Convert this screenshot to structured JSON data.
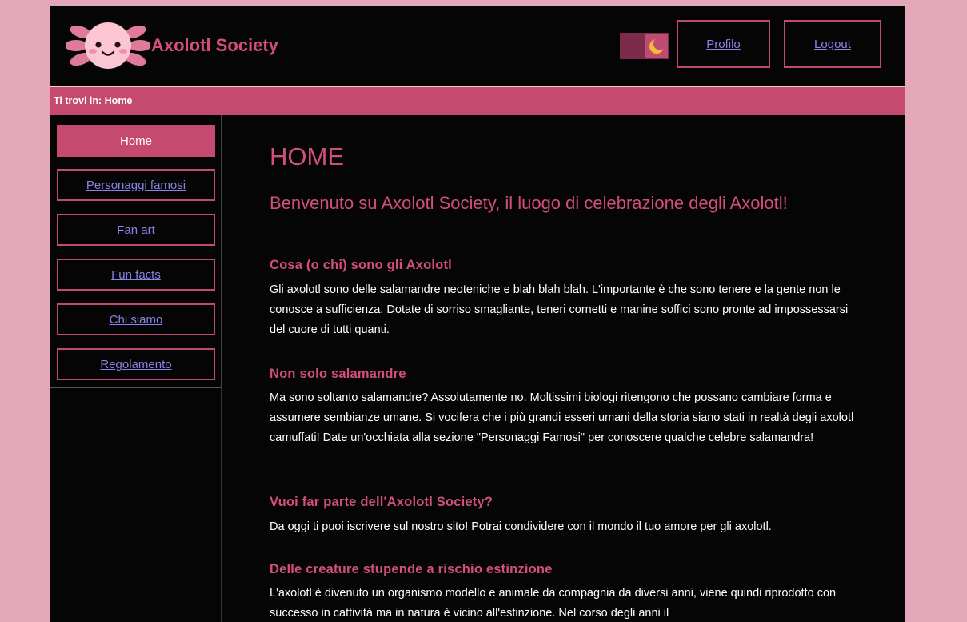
{
  "header": {
    "site_title": "Axolotl Society",
    "profile_label": "Profilo",
    "logout_label": "Logout",
    "theme_toggle_icon": "moon-icon"
  },
  "breadcrumb": {
    "text": "Ti trovi in: Home"
  },
  "sidebar": {
    "items": [
      {
        "label": "Home",
        "active": true
      },
      {
        "label": "Personaggi famosi",
        "active": false
      },
      {
        "label": "Fan art",
        "active": false
      },
      {
        "label": "Fun facts",
        "active": false
      },
      {
        "label": "Chi siamo",
        "active": false
      },
      {
        "label": "Regolamento",
        "active": false
      }
    ]
  },
  "main": {
    "title": "HOME",
    "subtitle": "Benvenuto su Axolotl Society, il luogo di celebrazione degli Axolotl!",
    "sections": [
      {
        "heading": "Cosa (o chi) sono gli Axolotl",
        "text": "Gli axolotl sono delle salamandre neoteniche e blah blah blah. L'importante è che sono tenere e la gente non le conosce a sufficienza. Dotate di sorriso smagliante, teneri cornetti e manine soffici sono pronte ad impossessarsi del cuore di tutti quanti."
      },
      {
        "heading": "Non solo salamandre",
        "text": "Ma sono soltanto salamandre? Assolutamente no. Moltissimi biologi ritengono che possano cambiare forma e assumere sembianze umane. Si vocifera che i più grandi esseri umani della storia siano stati in realtà degli axolotl camuffati! Date un'occhiata alla sezione \"Personaggi Famosi\" per conoscere qualche celebre salamandra!"
      },
      {
        "heading": "Vuoi far parte dell'Axolotl Society?",
        "text": "Da oggi ti puoi iscrivere sul nostro sito! Potrai condividere con il mondo il tuo amore per gli axolotl."
      },
      {
        "heading": "Delle creature stupende a rischio estinzione",
        "text": "L'axolotl è divenuto un organismo modello e animale da compagnia da diversi anni, viene quindi riprodotto con successo in cattività ma in natura è vicino all'estinzione. Nel corso degli anni il"
      }
    ]
  },
  "colors": {
    "accent": "#c6496f",
    "heading": "#d24f7a",
    "link": "#8a83e8",
    "page_bg": "#e3a7b8",
    "content_bg": "#050505"
  }
}
